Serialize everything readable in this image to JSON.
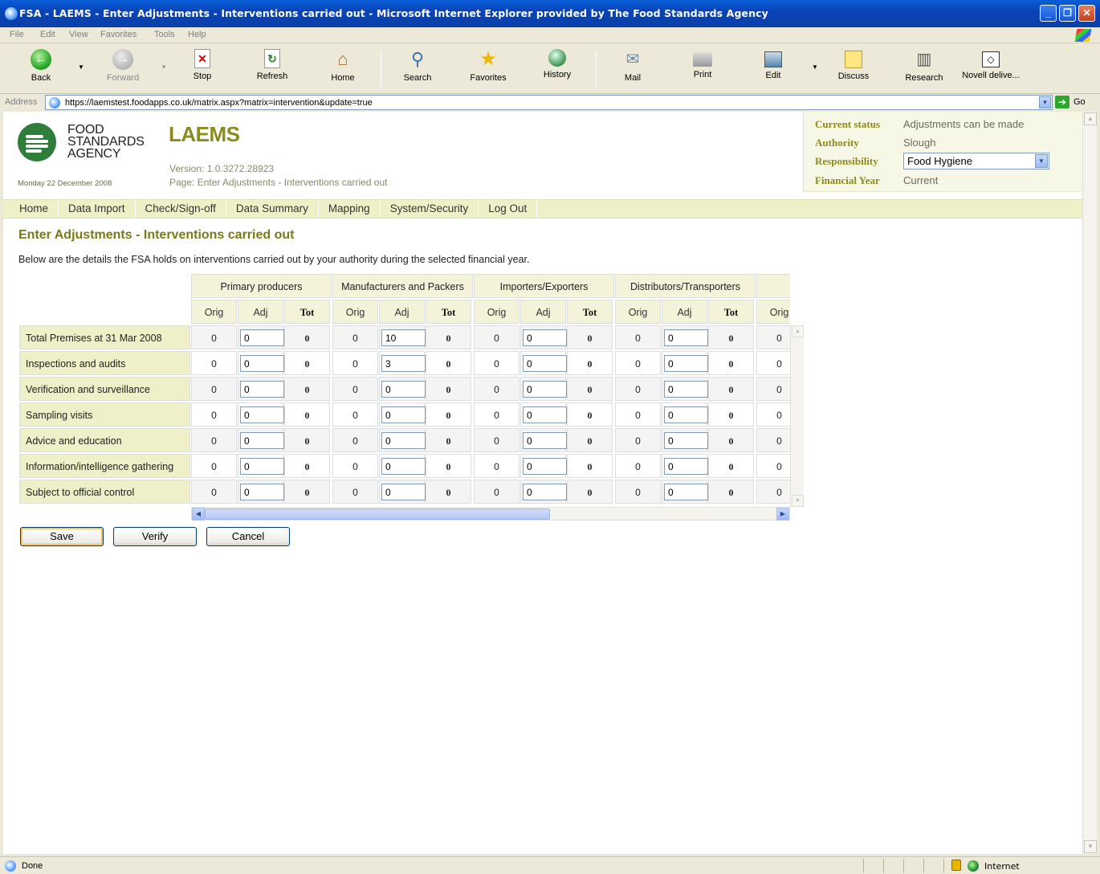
{
  "window": {
    "title": "FSA - LAEMS - Enter Adjustments - Interventions carried out - Microsoft Internet Explorer provided by The Food Standards Agency"
  },
  "menu": [
    "File",
    "Edit",
    "View",
    "Favorites",
    "Tools",
    "Help"
  ],
  "toolbar": {
    "back": "Back",
    "forward": "Forward",
    "stop": "Stop",
    "refresh": "Refresh",
    "home": "Home",
    "search": "Search",
    "favorites": "Favorites",
    "history": "History",
    "mail": "Mail",
    "print": "Print",
    "edit": "Edit",
    "discuss": "Discuss",
    "research": "Research",
    "novell": "Novell delive..."
  },
  "address": {
    "label": "Address",
    "url": "https://laemstest.foodapps.co.uk/matrix.aspx?matrix=intervention&update=true",
    "go": "Go"
  },
  "header": {
    "logo_lines": [
      "FOOD",
      "STANDARDS",
      "AGENCY"
    ],
    "date": "Monday 22 December 2008",
    "app_name": "LAEMS",
    "version": "Version: 1.0.3272.28923",
    "page": "Page: Enter Adjustments - Interventions carried out"
  },
  "status_panel": {
    "current_status_label": "Current status",
    "current_status": "Adjustments can be made",
    "authority_label": "Authority",
    "authority": "Slough",
    "responsibility_label": "Responsibility",
    "responsibility": "Food Hygiene",
    "financial_year_label": "Financial Year",
    "financial_year": "Current"
  },
  "nav": [
    "Home",
    "Data Import",
    "Check/Sign-off",
    "Data Summary",
    "Mapping",
    "System/Security",
    "Log Out"
  ],
  "page_title": "Enter Adjustments - Interventions carried out",
  "intro": "Below are the details the FSA holds on interventions carried out by your authority during the selected financial year.",
  "matrix": {
    "groups": [
      "Primary producers",
      "Manufacturers and Packers",
      "Importers/Exporters",
      "Distributors/Transporters",
      ""
    ],
    "sub_columns": [
      "Orig",
      "Adj",
      "Tot"
    ],
    "rows": [
      {
        "label": "Total Premises at 31 Mar 2008",
        "values": [
          [
            "0",
            "0",
            "0"
          ],
          [
            "0",
            "10",
            "0"
          ],
          [
            "0",
            "0",
            "0"
          ],
          [
            "0",
            "0",
            "0"
          ],
          [
            "0"
          ]
        ]
      },
      {
        "label": "Inspections and audits",
        "values": [
          [
            "0",
            "0",
            "0"
          ],
          [
            "0",
            "3",
            "0"
          ],
          [
            "0",
            "0",
            "0"
          ],
          [
            "0",
            "0",
            "0"
          ],
          [
            "0"
          ]
        ]
      },
      {
        "label": "Verification and surveillance",
        "values": [
          [
            "0",
            "0",
            "0"
          ],
          [
            "0",
            "0",
            "0"
          ],
          [
            "0",
            "0",
            "0"
          ],
          [
            "0",
            "0",
            "0"
          ],
          [
            "0"
          ]
        ]
      },
      {
        "label": "Sampling visits",
        "values": [
          [
            "0",
            "0",
            "0"
          ],
          [
            "0",
            "0",
            "0"
          ],
          [
            "0",
            "0",
            "0"
          ],
          [
            "0",
            "0",
            "0"
          ],
          [
            "0"
          ]
        ]
      },
      {
        "label": "Advice and education",
        "values": [
          [
            "0",
            "0",
            "0"
          ],
          [
            "0",
            "0",
            "0"
          ],
          [
            "0",
            "0",
            "0"
          ],
          [
            "0",
            "0",
            "0"
          ],
          [
            "0"
          ]
        ]
      },
      {
        "label": "Information/intelligence gathering",
        "values": [
          [
            "0",
            "0",
            "0"
          ],
          [
            "0",
            "0",
            "0"
          ],
          [
            "0",
            "0",
            "0"
          ],
          [
            "0",
            "0",
            "0"
          ],
          [
            "0"
          ]
        ]
      },
      {
        "label": "Subject to official control",
        "values": [
          [
            "0",
            "0",
            "0"
          ],
          [
            "0",
            "0",
            "0"
          ],
          [
            "0",
            "0",
            "0"
          ],
          [
            "0",
            "0",
            "0"
          ],
          [
            "0"
          ]
        ]
      }
    ]
  },
  "buttons": {
    "save": "Save",
    "verify": "Verify",
    "cancel": "Cancel"
  },
  "statusbar": {
    "text": "Done",
    "zone": "Internet"
  },
  "colors": {
    "accent": "#8b8b1e",
    "nav_bg": "#f0f0c8",
    "xp_blue": "#0a5fd8"
  }
}
